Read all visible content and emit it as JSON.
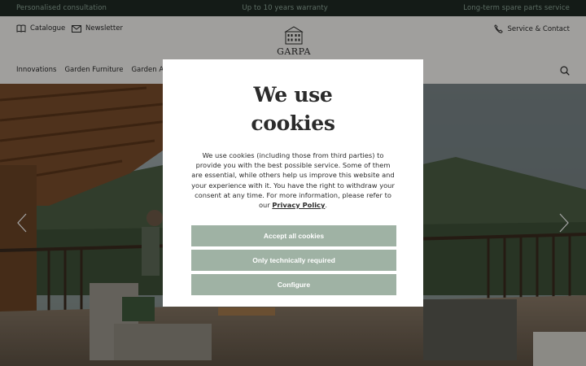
{
  "topbar": {
    "left": "Personalised consultation",
    "center": "Up to 10 years warranty",
    "right": "Long-term spare parts service"
  },
  "header": {
    "catalogue_label": "Catalogue",
    "newsletter_label": "Newsletter",
    "service_label": "Service & Contact",
    "logo_text": "GARPA"
  },
  "nav": {
    "items": [
      "Innovations",
      "Garden Furniture",
      "Garden Accessories"
    ]
  },
  "modal": {
    "title": "We use cookies",
    "body": "We use cookies (including those from third parties) to provide you with the best possible service. Some of them are essential, while others help us improve this website and your experience with it. You have the right to withdraw your consent at any time. For more information, please refer to our ",
    "privacy_link": "Privacy Policy",
    "period": ".",
    "accept_label": "Accept all cookies",
    "necessary_label": "Only technically required",
    "configure_label": "Configure"
  },
  "icons": {
    "catalogue": "book-icon",
    "newsletter": "mail-icon",
    "service": "phone-icon",
    "search": "search-icon",
    "prev": "chevron-left-icon",
    "next": "chevron-right-icon"
  },
  "colors": {
    "topbar_bg": "#1f2a24",
    "topbar_text": "#8fa89a",
    "button_bg": "#9fb2a4",
    "button_text": "#ffffff",
    "overlay": "rgba(0,0,0,0.35)"
  }
}
